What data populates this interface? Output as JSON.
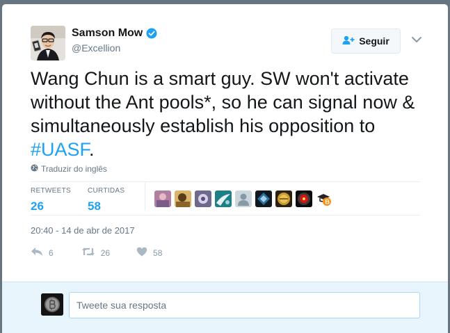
{
  "tweet": {
    "author": {
      "name": "Samson Mow",
      "handle": "@Excellion",
      "verified": true
    },
    "follow_label": "Seguir",
    "text_plain": "Wang Chun is a smart guy. SW won't activate without the Ant pools*, so he can signal now & simultaneously establish his opposition to ",
    "hashtag": "#UASF",
    "text_end": ".",
    "translate_label": "Traduzir do inglês",
    "stats": {
      "retweets_label": "RETWEETS",
      "retweets_value": "26",
      "likes_label": "CURTIDAS",
      "likes_value": "58"
    },
    "likers": [
      "liker-avatar-1",
      "liker-avatar-2",
      "liker-avatar-3",
      "liker-avatar-4",
      "liker-avatar-5",
      "liker-avatar-6",
      "liker-avatar-7",
      "liker-avatar-8",
      "liker-avatar-9"
    ],
    "timestamp": "20:40 - 14 de abr de 2017",
    "actions": {
      "reply_count": "6",
      "retweet_count": "26",
      "like_count": "58"
    }
  },
  "reply": {
    "placeholder": "Tweete sua resposta"
  },
  "colors": {
    "accent": "#1da1f2",
    "muted": "#657786",
    "backdrop": "#66757f",
    "reply_bg": "#e8f5fd"
  }
}
